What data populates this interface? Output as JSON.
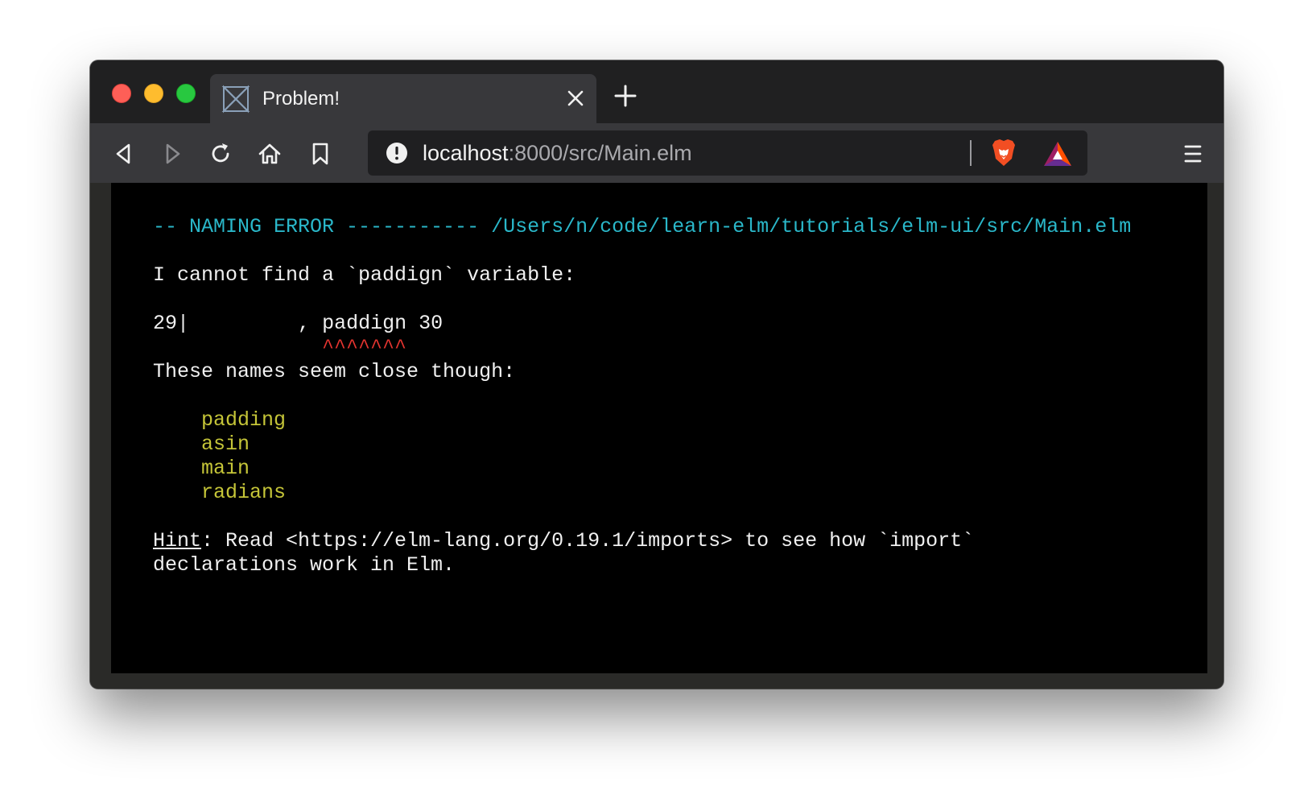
{
  "browser": {
    "tab": {
      "title": "Problem!"
    },
    "url": {
      "host": "localhost",
      "rest": ":8000/src/Main.elm"
    },
    "icons": [
      "back-icon",
      "forward-icon",
      "reload-icon",
      "home-icon",
      "bookmark-icon",
      "info-icon",
      "brave-shields-icon",
      "brave-rewards-icon",
      "menu-icon"
    ]
  },
  "error": {
    "header_prefix": "-- NAMING ERROR ----------- ",
    "header_path": "/Users/n/code/learn-elm/tutorials/elm-ui/src/Main.elm",
    "message": "I cannot find a `paddign` variable:",
    "code_line_number": "29",
    "code_separator": "|",
    "code_indent": "         , ",
    "code_highlight": "paddign",
    "code_after": " 30",
    "caret_indent": "              ",
    "carets": "^^^^^^^",
    "suggestions_intro": "These names seem close though:",
    "suggestions": [
      "padding",
      "asin",
      "main",
      "radians"
    ],
    "hint_label": "Hint",
    "hint_line1": ": Read <https://elm-lang.org/0.19.1/imports> to see how `import`",
    "hint_line2": "declarations work in Elm."
  },
  "colors": {
    "header": "#2ab7c9",
    "suggestion": "#c5c538",
    "caret": "#e4342f",
    "background": "#000000"
  }
}
